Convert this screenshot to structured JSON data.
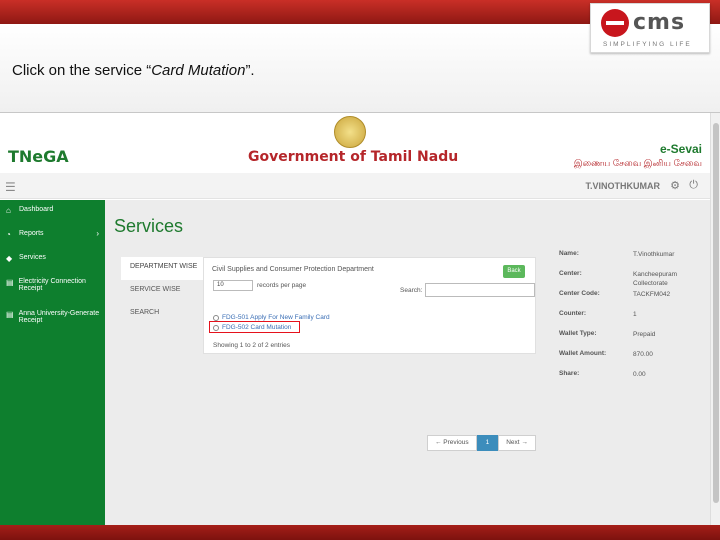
{
  "slide": {
    "caption_prefix": "Click on the service “",
    "caption_emph": "Card Mutation",
    "caption_suffix": "”.",
    "logo_word": "cms",
    "logo_tagline": "SIMPLIFYING LIFE"
  },
  "site": {
    "brand": "TNeGA",
    "gov_title": "Government of Tamil Nadu",
    "esevai": "e-Sevai",
    "esevai_tamil": "இணைய சேவை இனிய சேவை",
    "username": "T.VINOTHKUMAR"
  },
  "sidebar": {
    "items": [
      {
        "label": "Dashboard",
        "icon": "home-icon"
      },
      {
        "label": "Reports",
        "icon": "gauge-icon"
      },
      {
        "label": "Services",
        "icon": "tag-icon"
      },
      {
        "label": "Electricity Connection Receipt",
        "icon": "list-icon"
      },
      {
        "label": "Anna University-Generate Receipt",
        "icon": "list-icon"
      }
    ]
  },
  "main": {
    "title": "Services",
    "tabs": [
      "DEPARTMENT WISE",
      "SERVICE WISE",
      "SEARCH"
    ],
    "department": "Civil Supplies and Consumer Protection Department",
    "back_label": "Back",
    "page_length": "10",
    "records_label": "records per page",
    "search_label": "Search:",
    "services": [
      "FDG-501 Apply For New Family Card",
      "FDG-502 Card Mutation"
    ],
    "entries_text": "Showing 1 to 2 of 2 entries",
    "pager": {
      "previous": "← Previous",
      "current": "1",
      "next": "Next →"
    }
  },
  "info": [
    {
      "key": "Name:",
      "value": "T.Vinothkumar"
    },
    {
      "key": "Center:",
      "value": "Kancheepuram Collectorate"
    },
    {
      "key": "Center Code:",
      "value": "TACKFM042"
    },
    {
      "key": "Counter:",
      "value": "1"
    },
    {
      "key": "Wallet Type:",
      "value": "Prepaid"
    },
    {
      "key": "Wallet Amount:",
      "value": "870.00"
    },
    {
      "key": "Share:",
      "value": "0.00"
    }
  ],
  "colors": {
    "green": "#0e7f2e",
    "red_band": "#a51e18",
    "highlight_box": "#e5121c",
    "link": "#3a6eb5"
  }
}
